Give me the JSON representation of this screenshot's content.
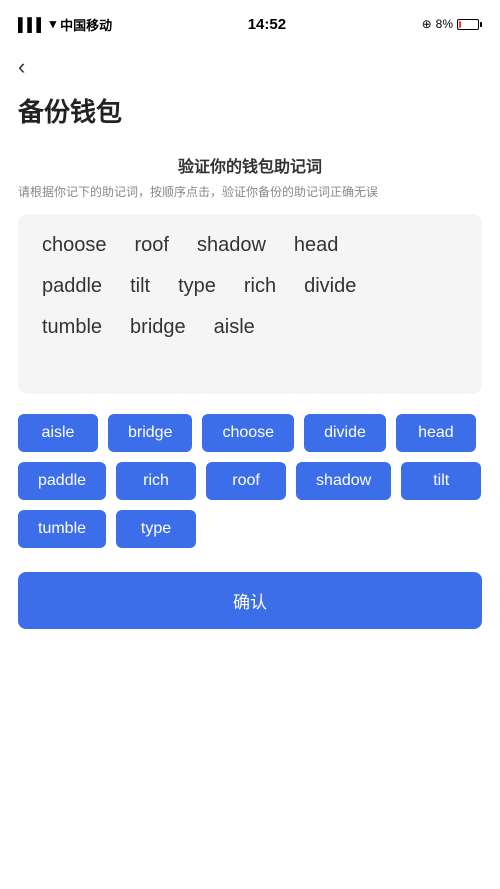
{
  "statusBar": {
    "carrier": "中国移动",
    "time": "14:52",
    "battery": "8%"
  },
  "page": {
    "backLabel": "‹",
    "title": "备份钱包",
    "sectionMainTitle": "验证你的钱包助记词",
    "sectionSubTitle": "请根据你记下的助记词，按顺序点击，验证你备份的助记词正确无误"
  },
  "displayWords": {
    "row1": [
      "choose",
      "roof",
      "shadow",
      "head"
    ],
    "row2": [
      "paddle",
      "tilt",
      "type",
      "rich",
      "divide"
    ],
    "row3": [
      "tumble",
      "bridge",
      "aisle"
    ]
  },
  "selectableWords": [
    "aisle",
    "bridge",
    "choose",
    "divide",
    "head",
    "paddle",
    "rich",
    "roof",
    "shadow",
    "tilt",
    "tumble",
    "type"
  ],
  "confirmButton": {
    "label": "确认"
  }
}
